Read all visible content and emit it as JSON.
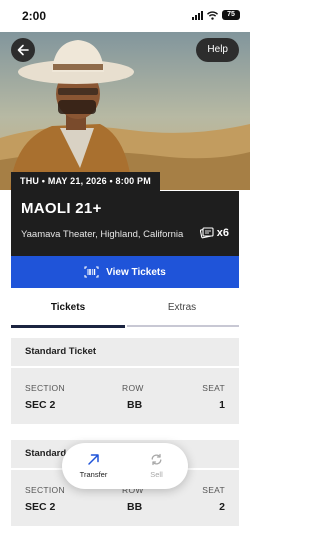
{
  "status_bar": {
    "time": "2:00",
    "battery": "75"
  },
  "header": {
    "back_icon": "arrow-left-icon",
    "help_label": "Help"
  },
  "event": {
    "date_time": "THU • MAY 21, 2026 • 8:00 PM",
    "title": "MAOLI 21+",
    "venue": "Yaamava Theater, Highland, California",
    "ticket_count": "x6",
    "ticket_icon": "tickets-icon"
  },
  "view_tickets": {
    "label": "View Tickets",
    "icon": "barcode-icon",
    "color": "#1f54d9"
  },
  "tabs": [
    {
      "label": "Tickets",
      "active": true
    },
    {
      "label": "Extras",
      "active": false
    }
  ],
  "tickets": [
    {
      "type": "Standard Ticket",
      "section_label": "SECTION",
      "section": "SEC 2",
      "row_label": "ROW",
      "row": "BB",
      "seat_label": "SEAT",
      "seat": "1"
    },
    {
      "type": "Standard",
      "section_label": "SECTION",
      "section": "SEC 2",
      "row_label": "ROW",
      "row": "BB",
      "seat_label": "SEAT",
      "seat": "2"
    }
  ],
  "actions": {
    "transfer_label": "Transfer",
    "transfer_icon": "arrow-up-right-icon",
    "sell_label": "Sell",
    "sell_icon": "refresh-icon"
  }
}
